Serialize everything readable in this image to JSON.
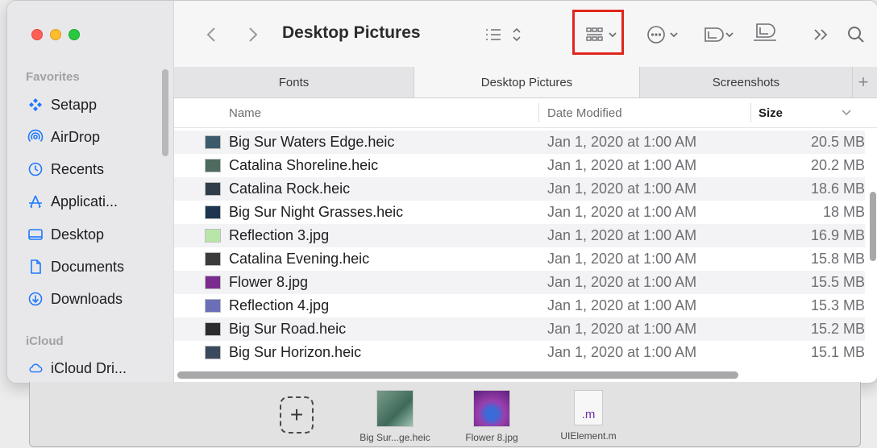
{
  "window": {
    "title": "Desktop Pictures",
    "traffic_lights": {
      "red": "#ff5f57",
      "yellow": "#febc2e",
      "green": "#28c840"
    }
  },
  "sidebar": {
    "favorites_label": "Favorites",
    "items": [
      {
        "label": "Setapp",
        "icon": "setapp-icon"
      },
      {
        "label": "AirDrop",
        "icon": "airdrop-icon"
      },
      {
        "label": "Recents",
        "icon": "clock-icon"
      },
      {
        "label": "Applicati...",
        "icon": "applications-icon"
      },
      {
        "label": "Desktop",
        "icon": "desktop-icon"
      },
      {
        "label": "Documents",
        "icon": "document-icon"
      },
      {
        "label": "Downloads",
        "icon": "download-icon"
      }
    ],
    "icloud_label": "iCloud",
    "icloud_items": [
      {
        "label": "iCloud Dri...",
        "icon": "cloud-icon"
      }
    ]
  },
  "toolbar": {
    "buttons": [
      "back-icon",
      "forward-icon",
      "list-view-icon",
      "group-icon",
      "more-icon",
      "tag-icon",
      "dropover-icon",
      "overflow-icon",
      "search-icon"
    ],
    "highlight_color": "#e0251c"
  },
  "tabs": [
    {
      "label": "Fonts",
      "active": false
    },
    {
      "label": "Desktop Pictures",
      "active": true
    },
    {
      "label": "Screenshots",
      "active": false
    }
  ],
  "columns": {
    "name": "Name",
    "date": "Date Modified",
    "size": "Size"
  },
  "files": [
    {
      "name": "Big Sur Waters Edge.heic",
      "date": "Jan 1, 2020 at 1:00 AM",
      "size": "20.5 MB",
      "thumb": "#3d5a6c"
    },
    {
      "name": "Catalina Shoreline.heic",
      "date": "Jan 1, 2020 at 1:00 AM",
      "size": "20.2 MB",
      "thumb": "#4d6b5e"
    },
    {
      "name": "Catalina Rock.heic",
      "date": "Jan 1, 2020 at 1:00 AM",
      "size": "18.6 MB",
      "thumb": "#2f3e4a"
    },
    {
      "name": "Big Sur Night Grasses.heic",
      "date": "Jan 1, 2020 at 1:00 AM",
      "size": "18 MB",
      "thumb": "#1d3550"
    },
    {
      "name": "Reflection 3.jpg",
      "date": "Jan 1, 2020 at 1:00 AM",
      "size": "16.9 MB",
      "thumb": "#b8e6a8"
    },
    {
      "name": "Catalina Evening.heic",
      "date": "Jan 1, 2020 at 1:00 AM",
      "size": "15.8 MB",
      "thumb": "#3b3b3b"
    },
    {
      "name": "Flower 8.jpg",
      "date": "Jan 1, 2020 at 1:00 AM",
      "size": "15.5 MB",
      "thumb": "#7b2c8f"
    },
    {
      "name": "Reflection 4.jpg",
      "date": "Jan 1, 2020 at 1:00 AM",
      "size": "15.3 MB",
      "thumb": "#6a6fb8"
    },
    {
      "name": "Big Sur Road.heic",
      "date": "Jan 1, 2020 at 1:00 AM",
      "size": "15.2 MB",
      "thumb": "#2c2c2e"
    },
    {
      "name": "Big Sur Horizon.heic",
      "date": "Jan 1, 2020 at 1:00 AM",
      "size": "15.1 MB",
      "thumb": "#3a4a5e"
    }
  ],
  "shelf": {
    "items": [
      {
        "label": "Big Sur...ge.heic",
        "thumb": "#4b7a6a"
      },
      {
        "label": "Flower 8.jpg",
        "thumb": "#7b2c8f"
      },
      {
        "label": "UIElement.m",
        "ext": ".m"
      }
    ]
  }
}
